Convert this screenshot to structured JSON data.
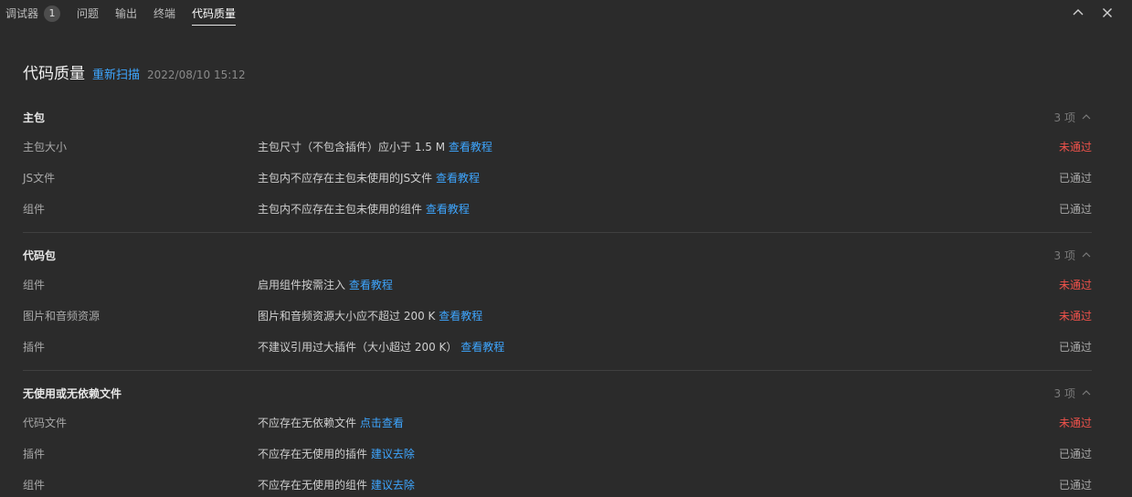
{
  "tabs": [
    {
      "label": "调试器",
      "badge": "1"
    },
    {
      "label": "问题"
    },
    {
      "label": "输出"
    },
    {
      "label": "终端"
    },
    {
      "label": "代码质量",
      "active": true
    }
  ],
  "header": {
    "title": "代码质量",
    "rescan": "重新扫描",
    "time": "2022/08/10 15:12"
  },
  "sections": [
    {
      "title": "主包",
      "count": "3 项",
      "rows": [
        {
          "name": "主包大小",
          "desc": "主包尺寸（不包含插件）应小于 1.5 M",
          "link": "查看教程",
          "status": "未通过"
        },
        {
          "name": "JS文件",
          "desc": "主包内不应存在主包未使用的JS文件",
          "link": "查看教程",
          "status": "已通过"
        },
        {
          "name": "组件",
          "desc": "主包内不应存在主包未使用的组件",
          "link": "查看教程",
          "status": "已通过"
        }
      ]
    },
    {
      "title": "代码包",
      "count": "3 项",
      "rows": [
        {
          "name": "组件",
          "desc": "启用组件按需注入",
          "link": "查看教程",
          "status": "未通过"
        },
        {
          "name": "图片和音频资源",
          "desc": "图片和音频资源大小应不超过 200 K",
          "link": "查看教程",
          "status": "未通过"
        },
        {
          "name": "插件",
          "desc": "不建议引用过大插件（大小超过 200 K）",
          "link": "查看教程",
          "status": "已通过"
        }
      ]
    },
    {
      "title": "无使用或无依赖文件",
      "count": "3 项",
      "rows": [
        {
          "name": "代码文件",
          "desc": "不应存在无依赖文件",
          "link": "点击查看",
          "status": "未通过"
        },
        {
          "name": "插件",
          "desc": "不应存在无使用的插件",
          "link": "建议去除",
          "status": "已通过"
        },
        {
          "name": "组件",
          "desc": "不应存在无使用的组件",
          "link": "建议去除",
          "status": "已通过"
        }
      ]
    }
  ],
  "colors": {
    "fail": "#f0524b",
    "pass": "#a8a8a8",
    "link": "#3ea6ff"
  },
  "icons": {
    "collapse": "chevron-up-icon",
    "close": "close-icon"
  }
}
